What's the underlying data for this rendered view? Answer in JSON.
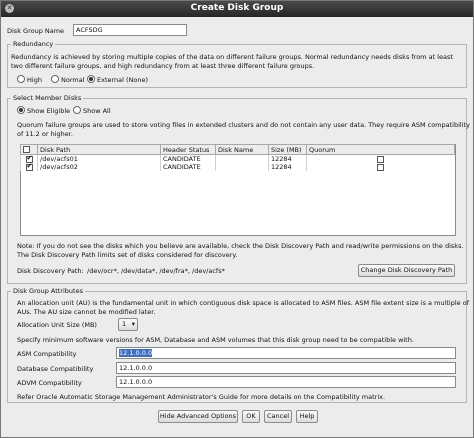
{
  "window": {
    "title": "Create Disk Group"
  },
  "disk_group_name": {
    "label": "Disk Group Name",
    "value": "ACFSDG"
  },
  "redundancy": {
    "legend": "Redundancy",
    "description_line1": "Redundancy is achieved by storing multiple copies of the data on different failure groups. Normal redundancy needs disks from at least",
    "description_line2": "two different failure groups, and high redundancy from at least three different failure groups.",
    "options": [
      {
        "label": "High",
        "selected": false
      },
      {
        "label": "Normal",
        "selected": false
      },
      {
        "label": "External (None)",
        "selected": true
      }
    ]
  },
  "member_disks": {
    "legend": "Select Member Disks",
    "filter_options": [
      {
        "label": "Show Eligible",
        "selected": true
      },
      {
        "label": "Show All",
        "selected": false
      }
    ],
    "quorum_note_line1": "Quorum failure groups are used to store voting files in extended clusters and do not contain any user data. They require ASM compatibility",
    "quorum_note_line2": "of 11.2 or higher.",
    "columns": [
      "Disk Path",
      "Header Status",
      "Disk Name",
      "Size (MB)",
      "Quorum"
    ],
    "rows": [
      {
        "checked": true,
        "disk_path": "/dev/acfs01",
        "header_status": "CANDIDATE",
        "disk_name": "",
        "size_mb": "12284",
        "quorum": false
      },
      {
        "checked": true,
        "disk_path": "/dev/acfs02",
        "header_status": "CANDIDATE",
        "disk_name": "",
        "size_mb": "12284",
        "quorum": false
      }
    ],
    "discovery_note_line1": "Note: If you do not see the disks which you believe are available, check the Disk Discovery Path and read/write permissions on the disks.",
    "discovery_note_line2": "The Disk Discovery Path limits set of disks considered for discovery.",
    "discovery_path_label": "Disk Discovery Path:",
    "discovery_path_value": "/dev/ocr*, /dev/data*, /dev/fra*, /dev/acfs*",
    "change_path_button": "Change Disk Discovery Path"
  },
  "attributes": {
    "legend": "Disk Group Attributes",
    "au_note_line1": "An allocation unit (AU) is the fundamental unit in which contiguous disk space is allocated to ASM files. ASM file extent size is a multiple of",
    "au_note_line2": "AUs. The AU size cannot be modified later.",
    "au_size_label": "Allocation Unit Size (MB)",
    "au_size_value": "1",
    "compat_note": "Specify minimum software versions for ASM, Database and ASM volumes that this disk group need to be compatible with.",
    "asm_label": "ASM Compatibility",
    "asm_value": "12.1.0.0.0",
    "db_label": "Database Compatibility",
    "db_value": "12.1.0.0.0",
    "advm_label": "ADVM Compatibility",
    "advm_value": "12.1.0.0.0",
    "refer_note": "Refer Oracle Automatic Storage Management Administrator's Guide for more details on the Compatibility matrix."
  },
  "buttons": {
    "hide_advanced": "Hide Advanced Options",
    "ok": "OK",
    "cancel": "Cancel",
    "help": "Help"
  }
}
